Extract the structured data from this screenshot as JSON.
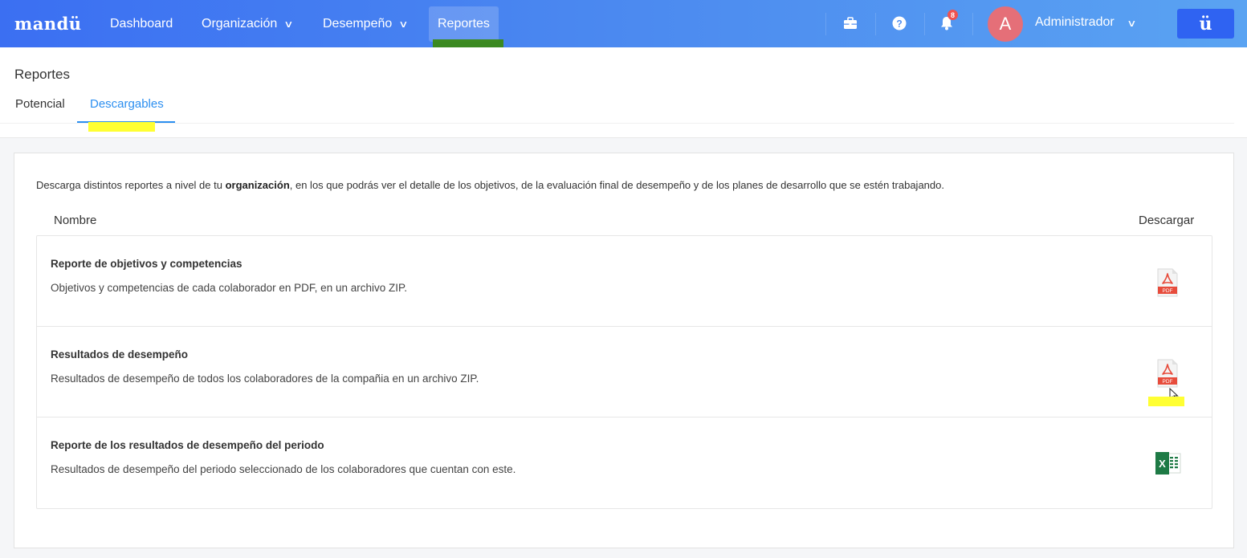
{
  "brand": {
    "logo": "mandü",
    "button_label": "ü"
  },
  "nav": {
    "items": [
      {
        "label": "Dashboard",
        "has_dropdown": false,
        "active": false
      },
      {
        "label": "Organización",
        "has_dropdown": true,
        "active": false
      },
      {
        "label": "Desempeño",
        "has_dropdown": true,
        "active": false
      },
      {
        "label": "Reportes",
        "has_dropdown": false,
        "active": true
      }
    ],
    "icons": [
      "briefcase-icon",
      "help-icon",
      "bell-icon"
    ],
    "notification_count": "8"
  },
  "user": {
    "avatar_initial": "A",
    "name": "Administrador",
    "avatar_color": "#e56f78"
  },
  "page": {
    "title": "Reportes",
    "tabs": [
      {
        "label": "Potencial",
        "active": false
      },
      {
        "label": "Descargables",
        "active": true
      }
    ]
  },
  "content": {
    "intro_prefix": "Descarga distintos reportes a nivel de tu ",
    "intro_bold": "organización",
    "intro_suffix": ", en los que podrás ver el detalle de los objetivos, de la evaluación final de desempeño y de los planes de desarrollo que se estén trabajando.",
    "columns": {
      "name": "Nombre",
      "download": "Descargar"
    },
    "reports": [
      {
        "title": "Reporte de objetivos y competencias",
        "description": "Objetivos y competencias de cada colaborador en PDF, en un archivo ZIP.",
        "file_type": "PDF"
      },
      {
        "title": "Resultados de desempeño",
        "description": "Resultados de desempeño de todos los colaboradores de la compañia en un archivo ZIP.",
        "file_type": "PDF"
      },
      {
        "title": "Reporte de los resultados de desempeño del periodo",
        "description": "Resultados de desempeño del periodo seleccionado de los colaboradores que cuentan con este.",
        "file_type": "XLS"
      }
    ]
  },
  "colors": {
    "accent": "#2c8ff0",
    "nav_start": "#3b6ff2",
    "nav_end": "#5aa3f2",
    "pdf_red": "#e74c3c",
    "excel_green": "#1e7a45",
    "highlight": "#ffff33"
  }
}
